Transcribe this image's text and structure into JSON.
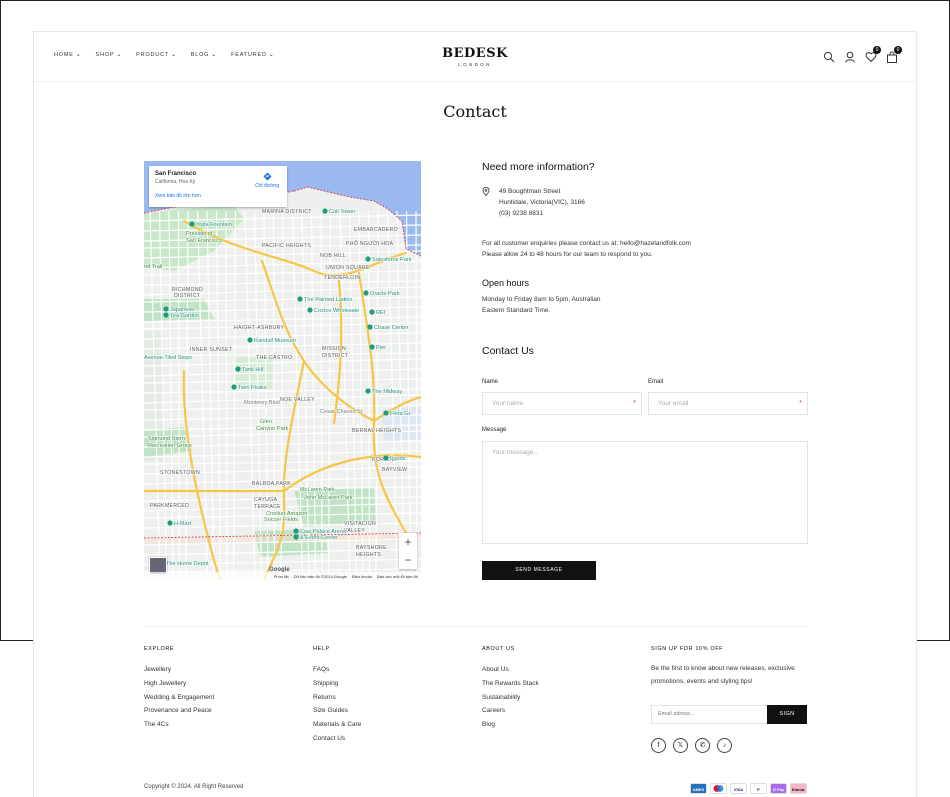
{
  "header": {
    "nav": [
      {
        "label": "HOME"
      },
      {
        "label": "SHOP"
      },
      {
        "label": "PRODUCT"
      },
      {
        "label": "BLOG"
      },
      {
        "label": "FEATURED"
      }
    ],
    "brand": "BEDESK",
    "brand_sub": "LONDON",
    "wishlist_count": "0",
    "cart_count": "0",
    "icons": [
      "search-icon",
      "user-icon",
      "heart-icon",
      "bag-icon"
    ]
  },
  "page_title": "Contact",
  "map": {
    "place": "San Francisco",
    "region": "California, Hoa Kỳ",
    "bigger_map": "Xem bản đồ lớn hơn",
    "directions": "Chỉ đường",
    "labels": [
      {
        "text": "Yoda Fountain",
        "type": "poi"
      },
      {
        "text": "Presidio of",
        "type": "area-green"
      },
      {
        "text": "San Francisco",
        "type": "area-green"
      },
      {
        "text": "MARINA DISTRICT",
        "type": "district"
      },
      {
        "text": "Coit Tower",
        "type": "poi"
      },
      {
        "text": "EMBARCADERO",
        "type": "district"
      },
      {
        "text": "PACIFIC HEIGHTS",
        "type": "district"
      },
      {
        "text": "PHỐ NGƯỜI HOA",
        "type": "district"
      },
      {
        "text": "NOB HILL",
        "type": "district"
      },
      {
        "text": "nd Trail",
        "type": "area-green"
      },
      {
        "text": "UNION SQUARE",
        "type": "district"
      },
      {
        "text": "TENDERLOIN",
        "type": "district"
      },
      {
        "text": "Salesforce Park",
        "type": "poi"
      },
      {
        "text": "RICHMOND",
        "type": "district"
      },
      {
        "text": "DISTRICT",
        "type": "district"
      },
      {
        "text": "The Painted Ladies",
        "type": "poi"
      },
      {
        "text": "Oracle Park",
        "type": "poi"
      },
      {
        "text": "Japanese",
        "type": "poi"
      },
      {
        "text": "Tea Garden",
        "type": "poi"
      },
      {
        "text": "Costco Wholesale",
        "type": "poi"
      },
      {
        "text": "REI",
        "type": "poi"
      },
      {
        "text": "HAIGHT-ASHBURY",
        "type": "district"
      },
      {
        "text": "Chase Center",
        "type": "poi"
      },
      {
        "text": "Randall Museum",
        "type": "poi"
      },
      {
        "text": "MISSION",
        "type": "district"
      },
      {
        "text": "DISTRICT",
        "type": "district"
      },
      {
        "text": "Pier",
        "type": "poi"
      },
      {
        "text": "INNER SUNSET",
        "type": "district"
      },
      {
        "text": "THE CASTRO",
        "type": "district"
      },
      {
        "text": "Avenue Tiled Steps",
        "type": "poi"
      },
      {
        "text": "Tank Hill",
        "type": "poi"
      },
      {
        "text": "Twin Peaks",
        "type": "poi"
      },
      {
        "text": "The Midway",
        "type": "poi"
      },
      {
        "text": "NOE VALLEY",
        "type": "district"
      },
      {
        "text": "Flora Gr",
        "type": "poi"
      },
      {
        "text": "Glen",
        "type": "area-green"
      },
      {
        "text": "Canyon Park",
        "type": "area-green"
      },
      {
        "text": "BERNAL HEIGHTS",
        "type": "district"
      },
      {
        "text": "Sigmund Stern",
        "type": "area-green"
      },
      {
        "text": "Recreation Grove",
        "type": "area-green"
      },
      {
        "text": "PORTOLA",
        "type": "district"
      },
      {
        "text": "Foods",
        "type": "poi"
      },
      {
        "text": "STONESTOWN",
        "type": "district"
      },
      {
        "text": "BAYVIEW",
        "type": "district"
      },
      {
        "text": "BALBOA PARK",
        "type": "district"
      },
      {
        "text": "McLaren Park",
        "type": "area-green"
      },
      {
        "text": "PARKMERCED",
        "type": "district"
      },
      {
        "text": "John McLaren Park",
        "type": "area-green"
      },
      {
        "text": "CAYUGA",
        "type": "district"
      },
      {
        "text": "TERRACE",
        "type": "district"
      },
      {
        "text": "Crocker Amazon",
        "type": "area-green"
      },
      {
        "text": "Soccer Fields",
        "type": "area-green"
      },
      {
        "text": "H-Mart",
        "type": "poi"
      },
      {
        "text": "VISITACION",
        "type": "district"
      },
      {
        "text": "VALLEY",
        "type": "district"
      },
      {
        "text": "Cow Palace Arena",
        "type": "poi"
      },
      {
        "text": "& Event Center",
        "type": "poi"
      },
      {
        "text": "BAYSHORE",
        "type": "district"
      },
      {
        "text": "HEIGHTS",
        "type": "district"
      },
      {
        "text": "The Home Depot",
        "type": "poi"
      },
      {
        "text": "Monterey Blvd",
        "type": "street"
      },
      {
        "text": "Cesar Chavez St",
        "type": "street"
      }
    ],
    "zoom_in": "+",
    "zoom_out": "−",
    "google": "Google",
    "footer": [
      "Phím tắt",
      "Dữ liệu bản đồ ©2024 Google",
      "Điều khoản",
      "Báo cáo một lỗi bản đồ"
    ]
  },
  "info": {
    "heading": "Need more information?",
    "address": [
      "49 Boughtman Street",
      "Huntidale, Victoria(VIC), 3166",
      "(03) 9238 8831"
    ],
    "enquiry": "For all customer enquiries please contact us at: hello@hazelandfolk.com",
    "response": "Please allow 24 to 48 hours for our team to respond to you.",
    "hours_title": "Open hours",
    "hours": [
      "Monday to Friday 8am to 5pm, Australian",
      "Eastern Standard Time."
    ]
  },
  "form": {
    "title": "Contact Us",
    "name_label": "Name",
    "name_placeholder": "Your name",
    "email_label": "Email",
    "email_placeholder": "Your email",
    "required_mark": "*",
    "message_label": "Message",
    "message_placeholder": "Your message...",
    "send": "SEND MESSAGE"
  },
  "footer": {
    "explore": {
      "title": "EXPLORE",
      "links": [
        "Jewellery",
        "High Jewellery",
        "Wedding & Engagement",
        "Provenance and Peace",
        "The 4Cs"
      ]
    },
    "help": {
      "title": "HELP",
      "links": [
        "FAQs",
        "Shipping",
        "Returns",
        "Size Guides",
        "Materials & Care",
        "Contact Us"
      ]
    },
    "about": {
      "title": "ABOUT US",
      "links": [
        "About Us",
        "The Rewards Stack",
        "Sustainability",
        "Careers",
        "Blog"
      ]
    },
    "signup": {
      "title": "SIGN UP FOR 10% OFF",
      "text": "Be the first to know about new releases, exclusive promotions, events and styling tips!",
      "placeholder": "Email adress...",
      "button": "SIGN",
      "socials": [
        "facebook-icon",
        "x-icon",
        "whatsapp-icon",
        "tiktok-icon"
      ]
    },
    "copyright": "Copyright © 2024. All Right Reserved",
    "payments": [
      {
        "label": "AMEX",
        "bg": "#2671b9",
        "fg": "#ffffff"
      },
      {
        "label": "",
        "bg": "#ffffff",
        "fg": "#000000"
      },
      {
        "label": "VISA",
        "bg": "#ffffff",
        "fg": "#1a1f71"
      },
      {
        "label": "P",
        "bg": "#ffffff",
        "fg": "#003087"
      },
      {
        "label": "G Pay",
        "bg": "#a66bea",
        "fg": "#ffffff"
      },
      {
        "label": "Klarna.",
        "bg": "#f7b6c8",
        "fg": "#17120f"
      }
    ]
  },
  "colors": {
    "accent": "#111111",
    "map_water": "#9ab9f0",
    "map_park": "#bfe3c4",
    "map_road": "#f6c64a"
  }
}
